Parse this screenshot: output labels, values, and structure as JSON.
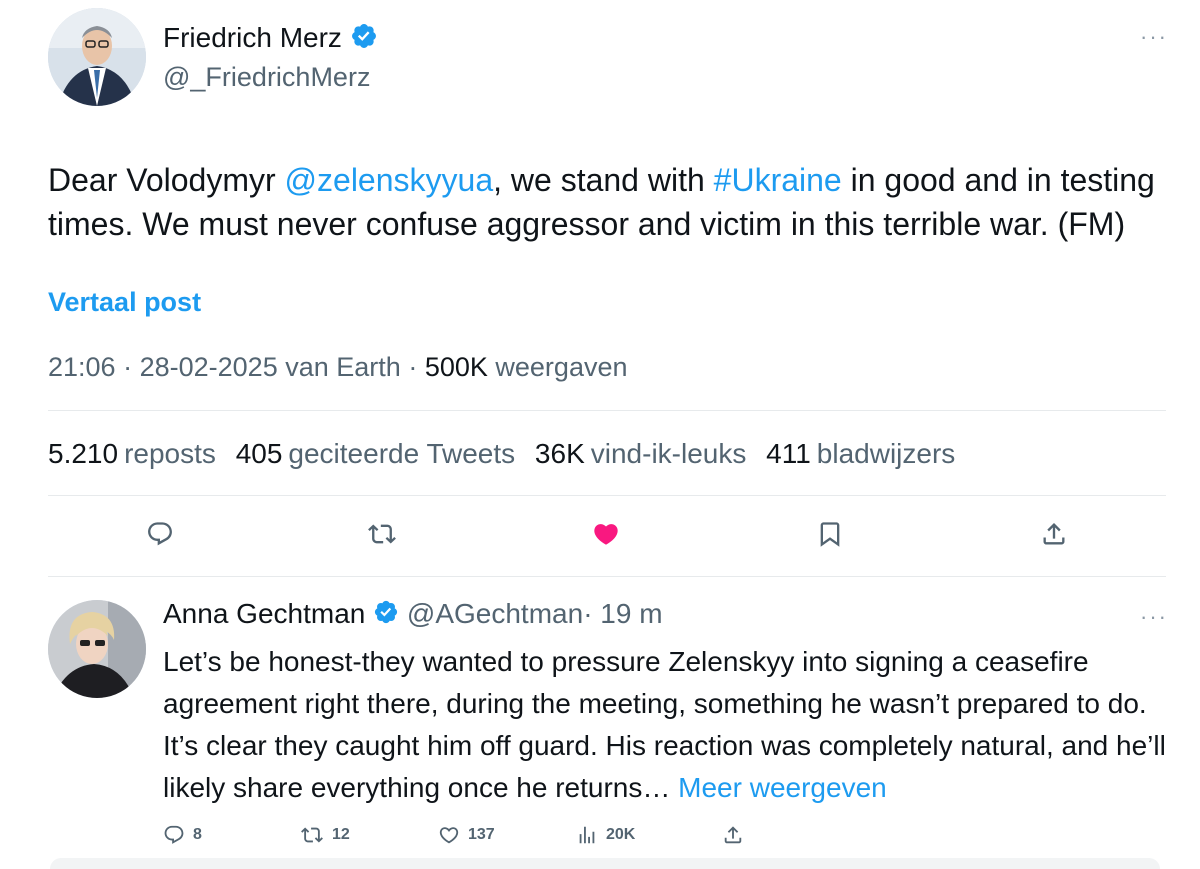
{
  "main_tweet": {
    "author_name": "Friedrich Merz",
    "author_handle": "@_FriedrichMerz",
    "more": "···",
    "text_part1": "Dear Volodymyr ",
    "mention": "@zelenskyyua",
    "text_part2": ", we stand with ",
    "hashtag": "#Ukraine",
    "text_part3": " in good and in testing times. We must never confuse aggressor and victim in this terrible war. (FM)",
    "translate_label": "Vertaal post",
    "time": "21:06",
    "date": "28-02-2025",
    "source": "van Earth",
    "views_count": "500K",
    "views_label": "weergaven",
    "stats": {
      "reposts_count": "5.210",
      "reposts_label": "reposts",
      "quotes_count": "405",
      "quotes_label": "geciteerde Tweets",
      "likes_count": "36K",
      "likes_label": "vind-ik-leuks",
      "bookmarks_count": "411",
      "bookmarks_label": "bladwijzers"
    },
    "actions": [
      "reply-icon",
      "repost-icon",
      "heart-icon-filled",
      "bookmark-icon",
      "share-icon"
    ]
  },
  "reply": {
    "author_name": "Anna Gechtman",
    "author_handle": "@AGechtman",
    "time": "· 19 m",
    "more": "···",
    "text": "Let’s be honest-they wanted to pressure Zelenskyy into signing a ceasefire agreement right there, during the meeting, something he wasn’t prepared to do. It’s clear they caught him off guard. His reaction was completely natural, and he’ll likely share everything once he returns…",
    "show_more": "Meer weergeven",
    "replies": "8",
    "reposts": "12",
    "likes": "137",
    "views": "20K"
  },
  "colors": {
    "accent": "#1d9bf0",
    "like": "#f91880",
    "muted": "#536471"
  }
}
